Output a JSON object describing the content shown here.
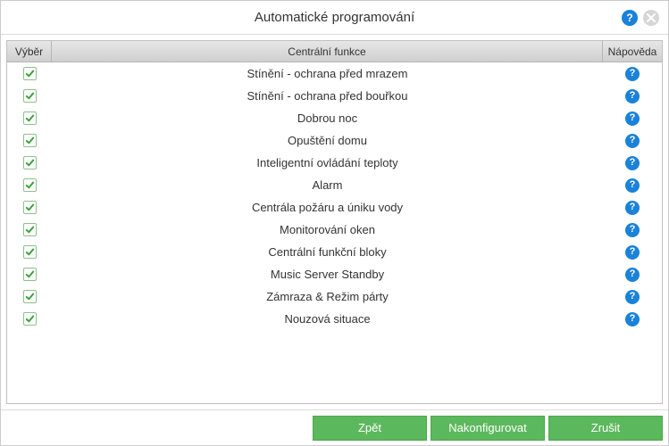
{
  "window": {
    "title": "Automatické programování"
  },
  "table": {
    "headers": {
      "select": "Výběr",
      "function": "Centrální funkce",
      "help": "Nápověda"
    },
    "rows": [
      {
        "checked": true,
        "label": "Stínění - ochrana před mrazem"
      },
      {
        "checked": true,
        "label": "Stínění - ochrana před bouřkou"
      },
      {
        "checked": true,
        "label": "Dobrou noc"
      },
      {
        "checked": true,
        "label": "Opuštění domu"
      },
      {
        "checked": true,
        "label": "Inteligentní ovládání teploty"
      },
      {
        "checked": true,
        "label": "Alarm"
      },
      {
        "checked": true,
        "label": "Centrála požáru a úniku vody"
      },
      {
        "checked": true,
        "label": "Monitorování oken"
      },
      {
        "checked": true,
        "label": "Centrální funkční bloky"
      },
      {
        "checked": true,
        "label": "Music Server Standby"
      },
      {
        "checked": true,
        "label": "Zámraza & Režim párty"
      },
      {
        "checked": true,
        "label": "Nouzová situace"
      }
    ]
  },
  "footer": {
    "back": "Zpět",
    "configure": "Nakonfigurovat",
    "cancel": "Zrušit"
  }
}
